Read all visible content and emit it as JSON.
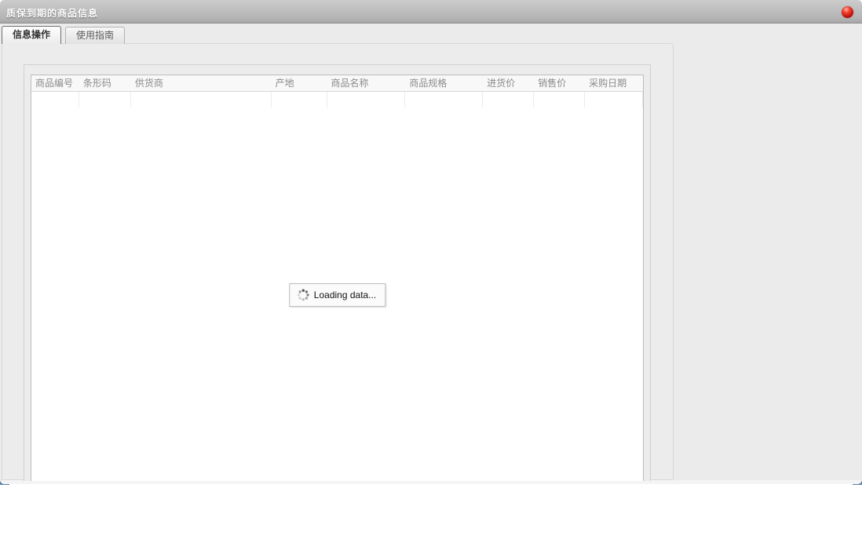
{
  "window": {
    "title": "质保到期的商品信息",
    "close_button": "close"
  },
  "tabs": [
    {
      "label": "信息操作",
      "active": true
    },
    {
      "label": "使用指南",
      "active": false
    }
  ],
  "table": {
    "columns": [
      "商品编号",
      "条形码",
      "供货商",
      "产地",
      "商品名称",
      "商品规格",
      "进货价",
      "销售价",
      "采购日期"
    ],
    "rows": []
  },
  "loading": {
    "text": "Loading data..."
  },
  "colors": {
    "close_button_red": "#c0120b",
    "corner_accent_blue": "#5b82a8",
    "titlebar_text": "#ffffff",
    "header_text": "#8b8b8b"
  }
}
